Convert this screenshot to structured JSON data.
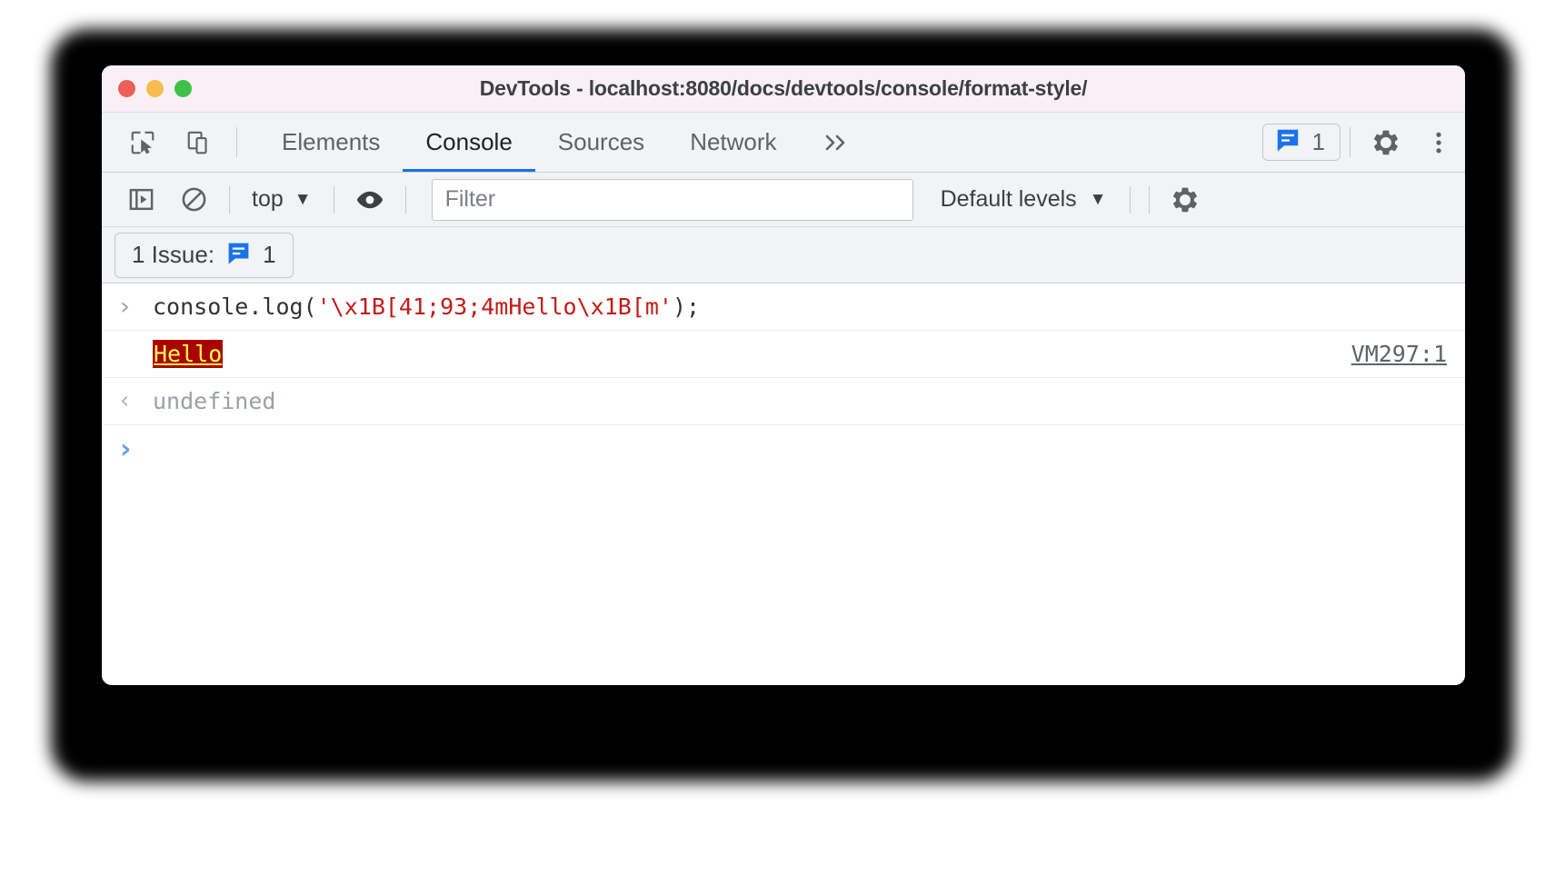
{
  "window": {
    "title": "DevTools - localhost:8080/docs/devtools/console/format-style/",
    "traffic_lights": [
      "close",
      "minimize",
      "maximize"
    ]
  },
  "tabbar": {
    "inspect_icon": "inspect-element-icon",
    "device_icon": "device-toolbar-icon",
    "tabs": [
      {
        "label": "Elements",
        "active": false
      },
      {
        "label": "Console",
        "active": true
      },
      {
        "label": "Sources",
        "active": false
      },
      {
        "label": "Network",
        "active": false
      }
    ],
    "overflow_label": "»",
    "issues_badge": {
      "icon": "issues-speech-bubble-icon",
      "count": "1"
    },
    "settings_icon": "gear-icon",
    "menu_icon": "kebab-menu-icon"
  },
  "console_toolbar": {
    "sidebar_toggle_icon": "console-sidebar-icon",
    "clear_icon": "clear-console-icon",
    "context": {
      "label": "top",
      "caret": "▼"
    },
    "eye_icon": "live-expression-eye-icon",
    "filter": {
      "value": "",
      "placeholder": "Filter"
    },
    "levels": {
      "label": "Default levels",
      "caret": "▼"
    },
    "settings_icon": "console-settings-gear-icon"
  },
  "issues_bar": {
    "label": "1 Issue:",
    "icon": "issues-speech-bubble-icon",
    "count": "1"
  },
  "console": {
    "command": {
      "prompt": "›",
      "prefix": "console.log(",
      "string": "'\\x1B[41;93;4mHello\\x1B[m'",
      "suffix": ");"
    },
    "output": {
      "text": "Hello",
      "background": "#aa0000",
      "color": "#ffff55",
      "underline": true,
      "source": "VM297:1"
    },
    "result": {
      "arrow": "‹",
      "value": "undefined"
    },
    "prompt": "›"
  },
  "colors": {
    "accent": "#1a73e8",
    "titlebar": "#f8f0f4",
    "toolbar": "#f1f3f4",
    "string_red": "#c41a16"
  }
}
